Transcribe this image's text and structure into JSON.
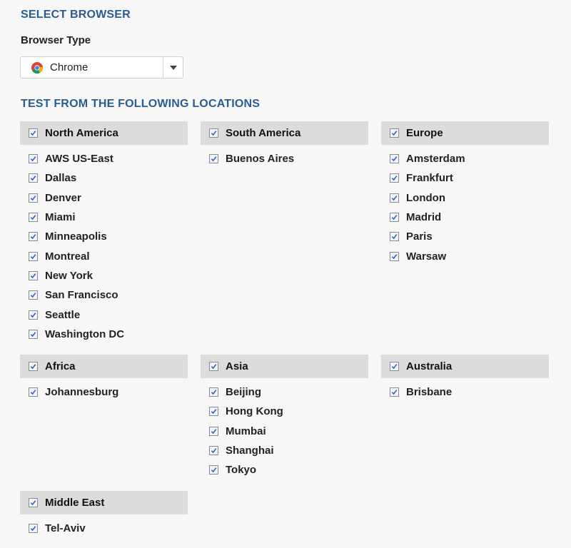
{
  "browser_section": {
    "title": "SELECT BROWSER",
    "field_label": "Browser Type",
    "selected": "Chrome",
    "selected_icon": "chrome-icon"
  },
  "locations_section": {
    "title": "TEST FROM THE FOLLOWING LOCATIONS",
    "groups": [
      {
        "name": "North America",
        "checked": true,
        "cities": [
          "AWS US-East",
          "Dallas",
          "Denver",
          "Miami",
          "Minneapolis",
          "Montreal",
          "New York",
          "San Francisco",
          "Seattle",
          "Washington DC"
        ]
      },
      {
        "name": "South America",
        "checked": true,
        "cities": [
          "Buenos Aires"
        ]
      },
      {
        "name": "Europe",
        "checked": true,
        "cities": [
          "Amsterdam",
          "Frankfurt",
          "London",
          "Madrid",
          "Paris",
          "Warsaw"
        ]
      },
      {
        "name": "Africa",
        "checked": true,
        "cities": [
          "Johannesburg"
        ]
      },
      {
        "name": "Asia",
        "checked": true,
        "cities": [
          "Beijing",
          "Hong Kong",
          "Mumbai",
          "Shanghai",
          "Tokyo"
        ]
      },
      {
        "name": "Australia",
        "checked": true,
        "cities": [
          "Brisbane"
        ]
      },
      {
        "name": "Middle East",
        "checked": true,
        "cities": [
          "Tel-Aviv"
        ]
      }
    ]
  },
  "colors": {
    "heading": "#2a5d8f",
    "group_header_bg": "#dcdcdc",
    "checkmark": "#3c64b4"
  }
}
